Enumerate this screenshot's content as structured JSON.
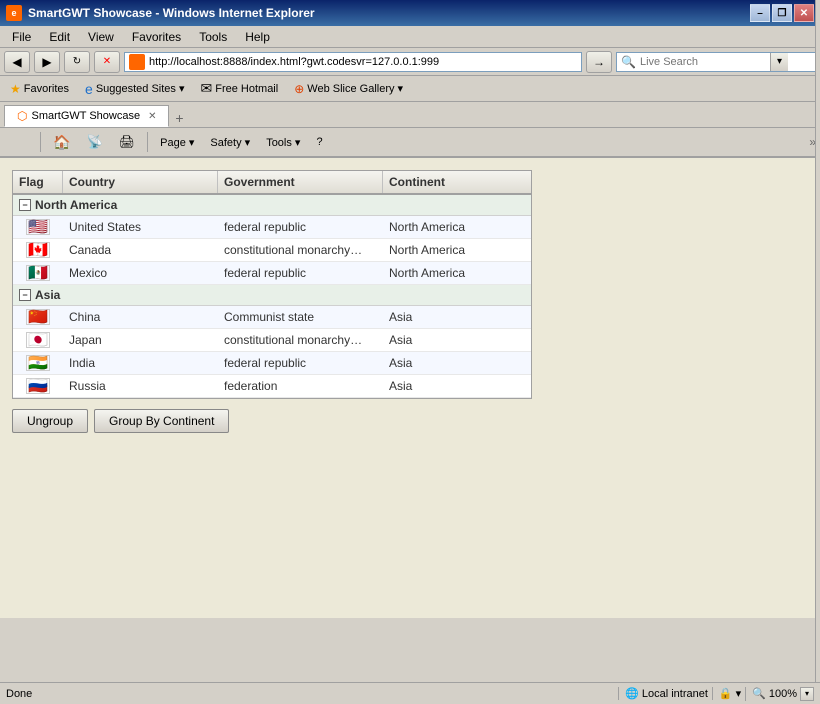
{
  "window": {
    "title": "SmartGWT Showcase - Windows Internet Explorer",
    "icon": "IE"
  },
  "titlebar": {
    "minimize": "–",
    "restore": "❒",
    "close": "✕"
  },
  "menubar": {
    "items": [
      "File",
      "Edit",
      "View",
      "Favorites",
      "Tools",
      "Help"
    ]
  },
  "addressbar": {
    "url": "http://localhost:8888/index.html?gwt.codesvr=127.0.0.1:999",
    "search_placeholder": "Live Search"
  },
  "favoritesbar": {
    "favorites_label": "Favorites",
    "suggested_sites": "Suggested Sites ▾",
    "hotmail": "Free Hotmail",
    "web_slice": "Web Slice Gallery ▾"
  },
  "tab": {
    "label": "SmartGWT Showcase",
    "new_tab": "+"
  },
  "commandbar": {
    "page_label": "Page ▾",
    "safety_label": "Safety ▾",
    "tools_label": "Tools ▾",
    "help_icon": "?"
  },
  "grid": {
    "columns": [
      "Flag",
      "Country",
      "Government",
      "Continent"
    ],
    "groups": [
      {
        "name": "North America",
        "expanded": true,
        "rows": [
          {
            "flag": "🇺🇸",
            "country": "United States",
            "government": "federal republic",
            "continent": "North America"
          },
          {
            "flag": "🇨🇦",
            "country": "Canada",
            "government": "constitutional monarchy…",
            "continent": "North America"
          },
          {
            "flag": "🇲🇽",
            "country": "Mexico",
            "government": "federal republic",
            "continent": "North America"
          }
        ]
      },
      {
        "name": "Asia",
        "expanded": true,
        "rows": [
          {
            "flag": "🇨🇳",
            "country": "China",
            "government": "Communist state",
            "continent": "Asia"
          },
          {
            "flag": "🇯🇵",
            "country": "Japan",
            "government": "constitutional monarchy…",
            "continent": "Asia"
          },
          {
            "flag": "🇮🇳",
            "country": "India",
            "government": "federal republic",
            "continent": "Asia"
          },
          {
            "flag": "🇷🇺",
            "country": "Russia",
            "government": "federation",
            "continent": "Asia"
          }
        ]
      }
    ]
  },
  "buttons": {
    "ungroup": "Ungroup",
    "group_by_continent": "Group By Continent"
  },
  "statusbar": {
    "status": "Done",
    "zone": "Local intranet",
    "zoom": "100%"
  }
}
